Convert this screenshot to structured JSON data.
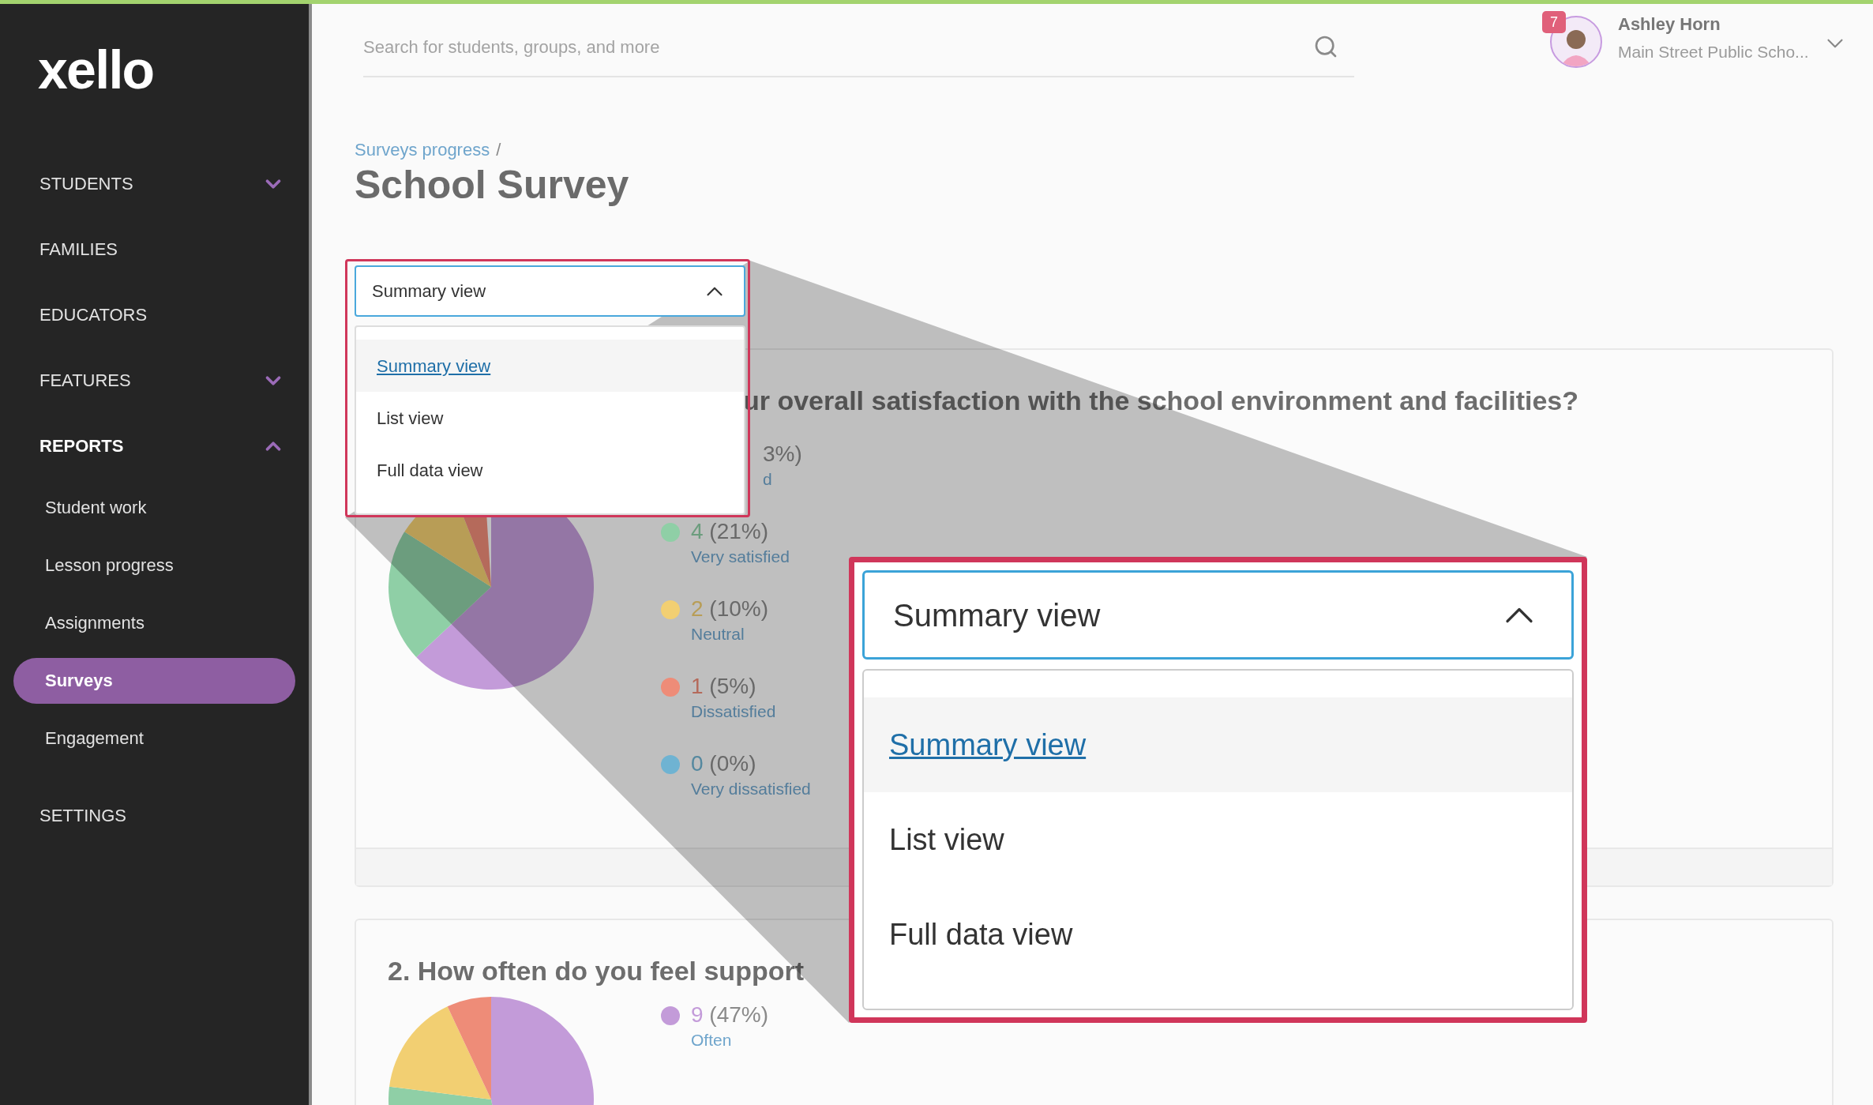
{
  "logo": "xello",
  "sidebar": {
    "items": [
      {
        "label": "STUDENTS",
        "kind": "group",
        "expanded": false
      },
      {
        "label": "FAMILIES",
        "kind": "link"
      },
      {
        "label": "EDUCATORS",
        "kind": "link"
      },
      {
        "label": "FEATURES",
        "kind": "group",
        "expanded": false
      },
      {
        "label": "REPORTS",
        "kind": "group",
        "expanded": true,
        "children": [
          {
            "label": "Student work",
            "selected": false
          },
          {
            "label": "Lesson progress",
            "selected": false
          },
          {
            "label": "Assignments",
            "selected": false
          },
          {
            "label": "Surveys",
            "selected": true
          },
          {
            "label": "Engagement",
            "selected": false
          }
        ]
      },
      {
        "label": "SETTINGS",
        "kind": "link"
      }
    ]
  },
  "header": {
    "search": {
      "placeholder": "Search for students, groups, and more"
    },
    "user": {
      "name": "Ashley Horn",
      "school": "Main Street Public Scho...",
      "notifications": "7"
    }
  },
  "breadcrumb": {
    "items": [
      "Surveys progress"
    ],
    "separator": "/"
  },
  "title": "School Survey",
  "view_select": {
    "value": "Summary view",
    "expanded": true,
    "options": [
      {
        "label": "Summary view",
        "selected": true
      },
      {
        "label": "List view",
        "selected": false
      },
      {
        "label": "Full data view",
        "selected": false
      }
    ]
  },
  "cards": [
    {
      "question": "ur overall satisfaction with the school environment and facilities?",
      "legend": [
        {
          "percent": "3%)",
          "label": "d"
        },
        {
          "count": "4",
          "percent": "(21%)",
          "label": "Very satisfied",
          "color": "#8fcfa6"
        },
        {
          "count": "2",
          "percent": "(10%)",
          "label": "Neutral",
          "color": "#f2cf72"
        },
        {
          "count": "1",
          "percent": "(5%)",
          "label": "Dissatisfied",
          "color": "#ee8c78"
        },
        {
          "count": "0",
          "percent": "(0%)",
          "label": "Very dissatisfied",
          "color": "#6fb3d2"
        }
      ]
    },
    {
      "question": "2. How often do you feel support",
      "legend": [
        {
          "count": "9",
          "percent": "(47%)",
          "label": "Often",
          "color": "#c39bd9"
        }
      ]
    }
  ],
  "callout": {
    "value": "Summary view",
    "expanded": true,
    "options": [
      {
        "label": "Summary view",
        "selected": true
      },
      {
        "label": "List view",
        "selected": false
      },
      {
        "label": "Full data view",
        "selected": false
      }
    ]
  }
}
